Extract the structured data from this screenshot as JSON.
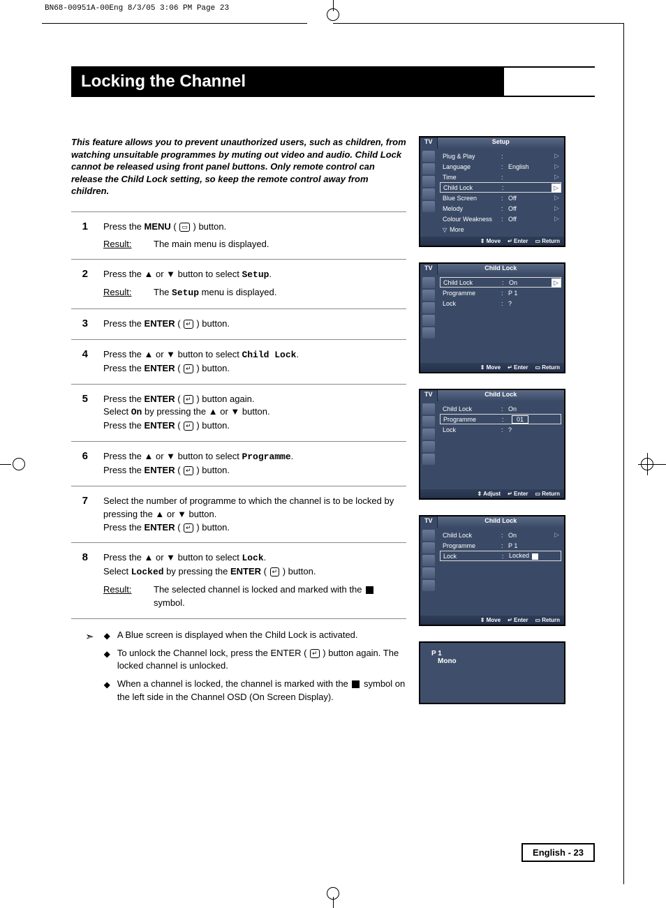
{
  "print_header": "BN68-00951A-00Eng  8/3/05  3:06 PM  Page 23",
  "title": "Locking the Channel",
  "intro": "This feature allows you to prevent unauthorized users, such as children, from watching unsuitable programmes by muting out video and audio. Child Lock cannot be released using front panel buttons. Only remote control can release the Child Lock setting, so keep the remote control away from children.",
  "steps": [
    {
      "num": "1",
      "text_parts": [
        "Press the ",
        {
          "b": "MENU"
        },
        " ( ",
        {
          "icon": "menu"
        },
        " ) button."
      ],
      "result": "The main menu is displayed."
    },
    {
      "num": "2",
      "text_parts": [
        "Press the ▲ or ▼ button to select ",
        {
          "mono": "Setup"
        },
        "."
      ],
      "result": "The Setup menu is displayed.",
      "result_mono_word": "Setup"
    },
    {
      "num": "3",
      "text_parts": [
        "Press the ",
        {
          "b": "ENTER"
        },
        " ( ",
        {
          "icon": "enter"
        },
        " ) button."
      ]
    },
    {
      "num": "4",
      "text_parts": [
        "Press the ▲ or ▼ button to select ",
        {
          "mono": "Child Lock"
        },
        ".\nPress the ",
        {
          "b": "ENTER"
        },
        " ( ",
        {
          "icon": "enter"
        },
        " ) button."
      ]
    },
    {
      "num": "5",
      "text_parts": [
        "Press the ",
        {
          "b": "ENTER"
        },
        " ( ",
        {
          "icon": "enter"
        },
        " ) button again.\nSelect ",
        {
          "mono": "On"
        },
        " by pressing the ▲ or ▼ button.\nPress the ",
        {
          "b": "ENTER"
        },
        " ( ",
        {
          "icon": "enter"
        },
        " ) button."
      ]
    },
    {
      "num": "6",
      "text_parts": [
        "Press the ▲ or ▼ button to select ",
        {
          "mono": "Programme"
        },
        ".\nPress the ",
        {
          "b": "ENTER"
        },
        " ( ",
        {
          "icon": "enter"
        },
        " ) button."
      ]
    },
    {
      "num": "7",
      "text_parts": [
        "Select the number of programme to which the channel is to be locked by pressing the ▲ or ▼ button.\nPress the ",
        {
          "b": "ENTER"
        },
        " ( ",
        {
          "icon": "enter"
        },
        " ) button."
      ]
    },
    {
      "num": "8",
      "text_parts": [
        "Press the ▲ or ▼ button to select ",
        {
          "mono": "Lock"
        },
        ".\nSelect ",
        {
          "mono": "Locked"
        },
        " by pressing the ",
        {
          "b": "ENTER"
        },
        " ( ",
        {
          "icon": "enter"
        },
        " ) button."
      ],
      "result": "The selected channel is locked and marked with the ⧈ symbol.",
      "result_has_lock_sym": true
    }
  ],
  "notes": [
    "A Blue screen is displayed when the Child Lock is activated.",
    "To unlock the Channel lock, press the ENTER ( ↵ ) button again. The locked channel is unlocked.",
    "When a channel is locked, the channel is marked with the ⧈ symbol on the left side in the Channel OSD (On Screen Display)."
  ],
  "notes_mono": {
    "0": "Child Lock",
    "1": "ENTER"
  },
  "osd1": {
    "tv": "TV",
    "title": "Setup",
    "rows": [
      {
        "lbl": "Plug & Play",
        "val": "",
        "tri": true
      },
      {
        "lbl": "Language",
        "val": "English",
        "tri": true
      },
      {
        "lbl": "Time",
        "val": "",
        "tri": true
      },
      {
        "lbl": "Child Lock",
        "val": "",
        "tri": true,
        "sel": true
      },
      {
        "lbl": "Blue Screen",
        "val": "Off",
        "tri": true
      },
      {
        "lbl": "Melody",
        "val": "Off",
        "tri": true
      },
      {
        "lbl": "Colour Weakness",
        "val": "Off",
        "tri": true
      },
      {
        "lbl": "More",
        "val": "",
        "more": true
      }
    ],
    "nav": [
      "Move",
      "Enter",
      "Return"
    ]
  },
  "osd2": {
    "tv": "TV",
    "title": "Child Lock",
    "rows": [
      {
        "lbl": "Child Lock",
        "val": "On",
        "tri": true,
        "sel": true
      },
      {
        "lbl": "Programme",
        "val": "P    1"
      },
      {
        "lbl": "Lock",
        "val": "?"
      }
    ],
    "nav": [
      "Move",
      "Enter",
      "Return"
    ]
  },
  "osd3": {
    "tv": "TV",
    "title": "Child Lock",
    "rows": [
      {
        "lbl": "Child Lock",
        "val": "On"
      },
      {
        "lbl": "Programme",
        "valbox": "01",
        "sel": true
      },
      {
        "lbl": "Lock",
        "val": "?"
      }
    ],
    "nav": [
      "Adjust",
      "Enter",
      "Return"
    ]
  },
  "osd4": {
    "tv": "TV",
    "title": "Child Lock",
    "rows": [
      {
        "lbl": "Child Lock",
        "val": "On",
        "tri": true,
        "tri_dim": true
      },
      {
        "lbl": "Programme",
        "val": "P    1"
      },
      {
        "lbl": "Lock",
        "val": "Locked",
        "sel": true,
        "lockicon": true
      }
    ],
    "nav": [
      "Move",
      "Enter",
      "Return"
    ]
  },
  "osd5": {
    "line1": "P   1",
    "line2": "Mono"
  },
  "page_num": "English - 23"
}
